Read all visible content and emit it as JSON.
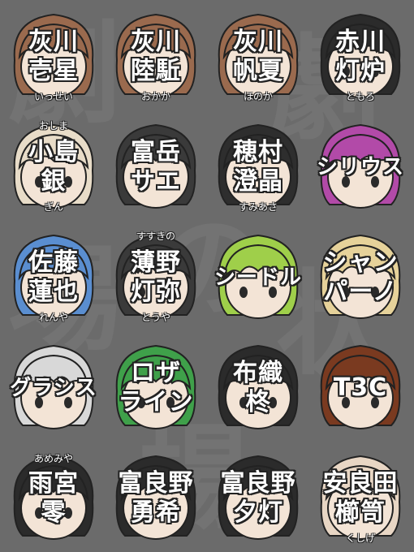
{
  "colors": {
    "background": "#6b6b6b",
    "text": "#ffffff",
    "outline": "#222222",
    "skin": "#f3e4d6"
  },
  "characters": [
    {
      "lines": [
        "灰川",
        "壱星"
      ],
      "ruby": "いっせい",
      "ruby_pos": "bottom",
      "hair": "#9a6a4e"
    },
    {
      "lines": [
        "灰川",
        "陸駈"
      ],
      "ruby": "おかか",
      "ruby_pos": "bottom",
      "hair": "#9a6a4e"
    },
    {
      "lines": [
        "灰川",
        "帆夏"
      ],
      "ruby": "ほのか",
      "ruby_pos": "bottom",
      "hair": "#9a6a4e"
    },
    {
      "lines": [
        "赤川",
        "灯炉"
      ],
      "ruby": "ともろ",
      "ruby_pos": "bottom",
      "hair": "#2b2b2b"
    },
    {
      "lines": [
        "小島",
        "銀"
      ],
      "ruby": "おしま",
      "ruby2": "ぎん",
      "ruby_pos": "both",
      "hair": "#e8dcc8"
    },
    {
      "lines": [
        "富岳",
        "サエ"
      ],
      "ruby": "",
      "ruby_pos": "none",
      "hair": "#3a3a3a"
    },
    {
      "lines": [
        "穂村",
        "澄晶"
      ],
      "ruby": "すみあさ",
      "ruby_pos": "bottom",
      "hair": "#2e2e2e"
    },
    {
      "lines": [
        "シリウス"
      ],
      "ruby": "",
      "ruby_pos": "none",
      "hair": "#b24aa8"
    },
    {
      "lines": [
        "佐藤",
        "蓮也"
      ],
      "ruby": "れんや",
      "ruby_pos": "bottom",
      "hair": "#5a8ed0"
    },
    {
      "lines": [
        "薄野",
        "灯弥"
      ],
      "ruby": "すすきの",
      "ruby2": "とうや",
      "ruby_pos": "both",
      "hair": "#3a3a3a"
    },
    {
      "lines": [
        "シードル"
      ],
      "ruby": "",
      "ruby_pos": "none",
      "hair": "#9fcf4a"
    },
    {
      "lines": [
        "シャン",
        "パーノ"
      ],
      "ruby": "",
      "ruby_pos": "none",
      "hair": "#e6d29a"
    },
    {
      "lines": [
        "グラシス"
      ],
      "ruby": "",
      "ruby_pos": "none",
      "hair": "#d8d8d8"
    },
    {
      "lines": [
        "ロザ",
        "ライン"
      ],
      "ruby": "",
      "ruby_pos": "none",
      "hair": "#3fa04a"
    },
    {
      "lines": [
        "布織",
        "柊"
      ],
      "ruby": "",
      "ruby_pos": "none",
      "hair": "#2b2b2b"
    },
    {
      "lines": [
        "T3C"
      ],
      "ruby": "",
      "ruby_pos": "none",
      "hair": "#7a3a20"
    },
    {
      "lines": [
        "雨宮",
        "零"
      ],
      "ruby": "あめみや",
      "ruby_pos": "top",
      "hair": "#2b2b2b"
    },
    {
      "lines": [
        "富良野",
        "勇希"
      ],
      "ruby": "",
      "ruby_pos": "none",
      "hair": "#2b2b2b"
    },
    {
      "lines": [
        "富良野",
        "夕灯"
      ],
      "ruby": "",
      "ruby_pos": "none",
      "hair": "#2b2b2b"
    },
    {
      "lines": [
        "安良田",
        "櫛笥"
      ],
      "ruby": "くしげ",
      "ruby_pos": "bottom",
      "hair": "#e8d6c4"
    }
  ]
}
